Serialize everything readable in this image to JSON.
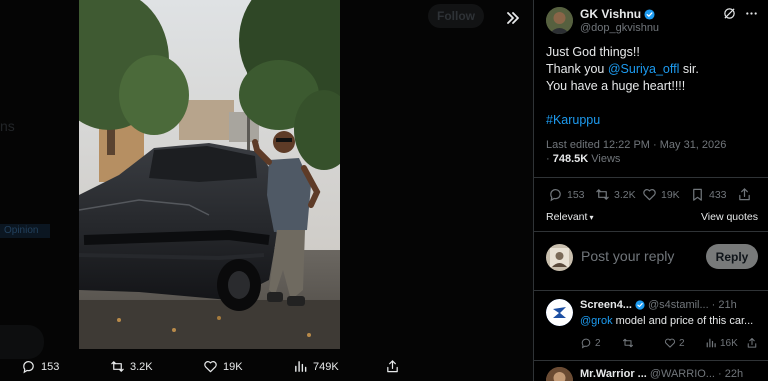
{
  "viewer": {
    "ghost_follow": "Follow",
    "ghost_tag": "Opinion",
    "actions": {
      "replies": "153",
      "reposts": "3.2K",
      "likes": "19K",
      "views": "749K"
    }
  },
  "post": {
    "author_name": "GK Vishnu",
    "author_handle": "@dop_gkvishnu",
    "line1": "Just God things!!",
    "line2_prefix": "Thank you ",
    "mention": "@Suriya_offl",
    "line2_suffix": " sir.",
    "line3": "You have a huge heart!!!!",
    "hashtag": "#Karuppu",
    "edited": "Last edited 12:22 PM · May 31, 2026",
    "views_sep": "· ",
    "views_count": "748.5K",
    "views_label": " Views",
    "stats": {
      "replies": "153",
      "reposts": "3.2K",
      "likes": "19K",
      "bookmarks": "433"
    },
    "sort_label": "Relevant",
    "view_quotes": "View quotes"
  },
  "composer": {
    "placeholder": "Post your reply",
    "reply_button": "Reply"
  },
  "replies": [
    {
      "name": "Screen4...",
      "handle": "@s4stamil...",
      "time": "· 21h",
      "mention": "@grok",
      "text": " model and price of this car...",
      "stats": {
        "replies": "2",
        "reposts": "",
        "likes": "2",
        "views": "16K"
      }
    },
    {
      "name": "Mr.Warrior ...",
      "handle": "@WARRIO...",
      "time": "· 22h"
    }
  ],
  "colors": {
    "accent": "#1d9bf0",
    "muted": "#71767b",
    "verified": "#1d9bf0",
    "reply_avatar": "#1d4fa3"
  }
}
